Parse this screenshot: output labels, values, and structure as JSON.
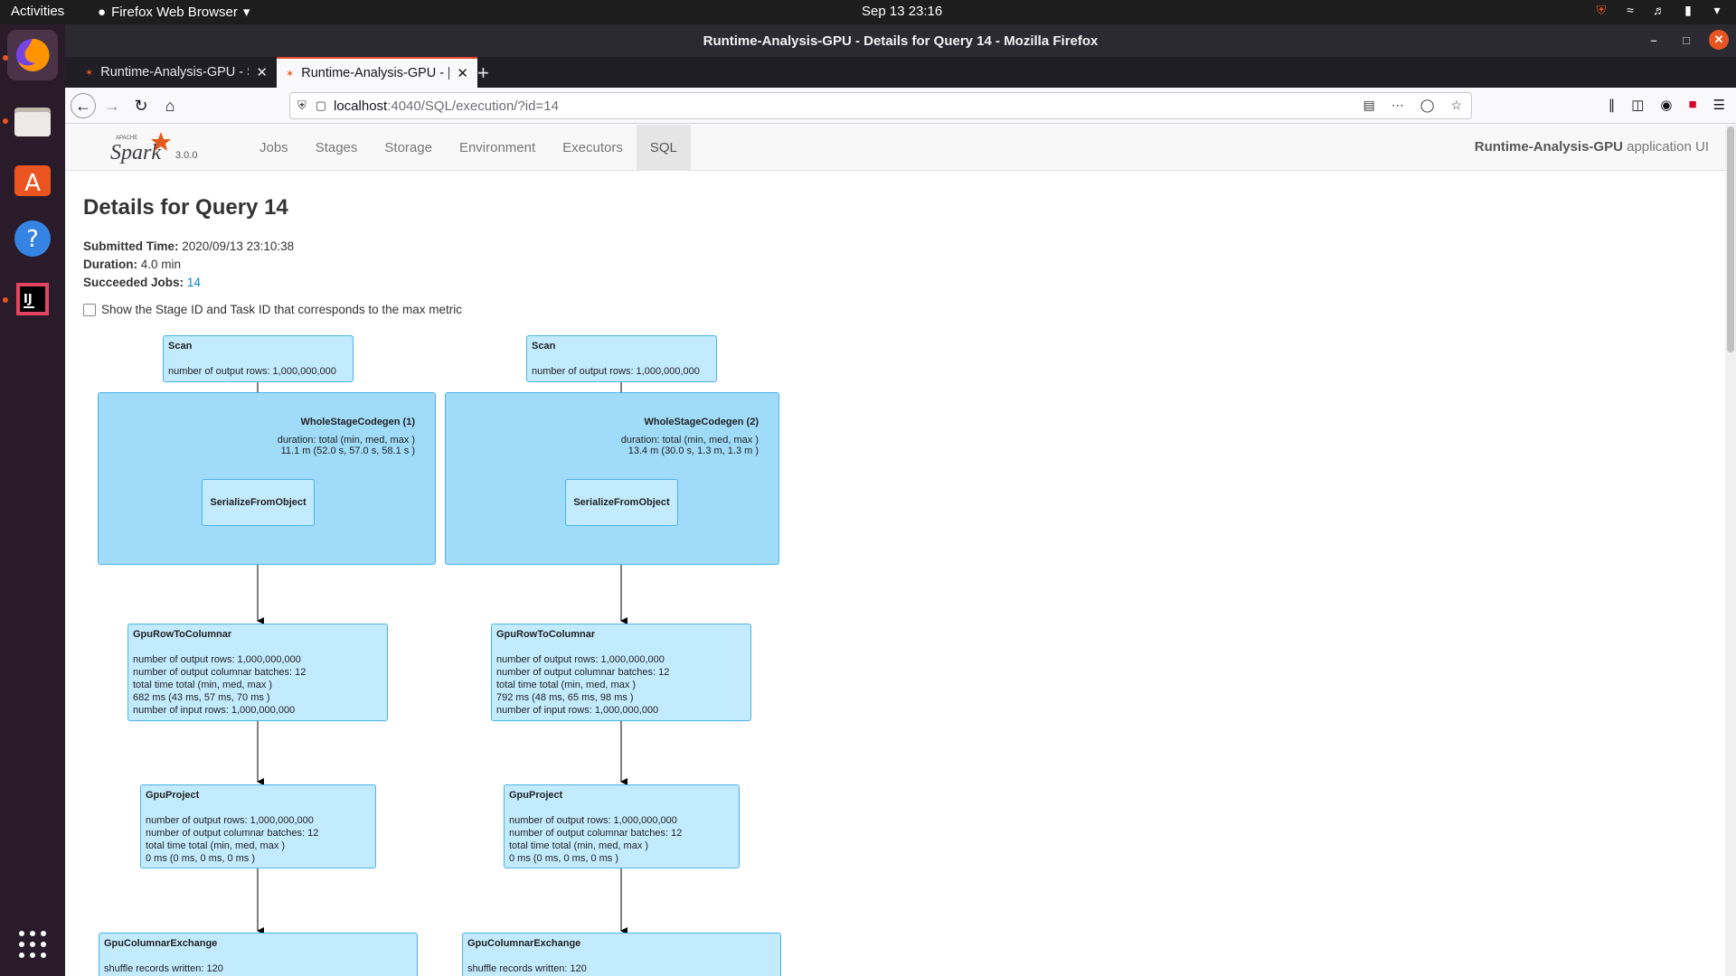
{
  "topbar": {
    "activities": "Activities",
    "app_menu": "Firefox Web Browser",
    "clock": "Sep 13  23:16"
  },
  "window": {
    "title": "Runtime-Analysis-GPU - Details for Query 14 - Mozilla Firefox"
  },
  "tabs": [
    {
      "label": "Runtime-Analysis-GPU - S"
    },
    {
      "label": "Runtime-Analysis-GPU - [ "
    }
  ],
  "url": {
    "host": "localhost",
    "path": ":4040/SQL/execution/?id=14"
  },
  "spark": {
    "version": "3.0.0",
    "nav": [
      "Jobs",
      "Stages",
      "Storage",
      "Environment",
      "Executors",
      "SQL"
    ],
    "active_nav": "SQL",
    "app_name_bold": "Runtime-Analysis-GPU",
    "app_name_suffix": " application UI"
  },
  "page": {
    "title": "Details for Query 14",
    "submitted_label": "Submitted Time:",
    "submitted_value": " 2020/09/13 23:10:38",
    "duration_label": "Duration:",
    "duration_value": " 4.0 min",
    "jobs_label": "Succeeded Jobs:",
    "jobs_value": "14",
    "checkbox_label": "Show the Stage ID and Task ID that corresponds to the max metric"
  },
  "plan": {
    "left": {
      "scan": {
        "name": "Scan",
        "metrics": [
          "number of output rows: 1,000,000,000"
        ]
      },
      "codegen": {
        "name": "WholeStageCodegen (1)",
        "metrics": [
          "duration: total (min, med, max )",
          "11.1 m (52.0 s, 57.0 s, 58.1 s )"
        ]
      },
      "serialize": {
        "name": "SerializeFromObject"
      },
      "rowtocol": {
        "name": "GpuRowToColumnar",
        "metrics": [
          "number of output rows: 1,000,000,000",
          "number of output columnar batches: 12",
          "total time total (min, med, max )",
          "682 ms (43 ms, 57 ms, 70 ms )",
          "number of input rows: 1,000,000,000"
        ]
      },
      "project": {
        "name": "GpuProject",
        "metrics": [
          "number of output rows: 1,000,000,000",
          "number of output columnar batches: 12",
          "total time total (min, med, max )",
          "0 ms (0 ms, 0 ms, 0 ms )"
        ]
      },
      "exchange": {
        "name": "GpuColumnarExchange",
        "metrics": [
          "shuffle records written: 120"
        ]
      }
    },
    "right": {
      "scan": {
        "name": "Scan",
        "metrics": [
          "number of output rows: 1,000,000,000"
        ]
      },
      "codegen": {
        "name": "WholeStageCodegen (2)",
        "metrics": [
          "duration: total (min, med, max )",
          "13.4 m (30.0 s, 1.3 m, 1.3 m )"
        ]
      },
      "serialize": {
        "name": "SerializeFromObject"
      },
      "rowtocol": {
        "name": "GpuRowToColumnar",
        "metrics": [
          "number of output rows: 1,000,000,000",
          "number of output columnar batches: 12",
          "total time total (min, med, max )",
          "792 ms (48 ms, 65 ms, 98 ms )",
          "number of input rows: 1,000,000,000"
        ]
      },
      "project": {
        "name": "GpuProject",
        "metrics": [
          "number of output rows: 1,000,000,000",
          "number of output columnar batches: 12",
          "total time total (min, med, max )",
          "0 ms (0 ms, 0 ms, 0 ms )"
        ]
      },
      "exchange": {
        "name": "GpuColumnarExchange",
        "metrics": [
          "shuffle records written: 120"
        ]
      }
    }
  },
  "colors": {
    "node_fill": "#c3ebff",
    "cluster_fill": "#a0dcfa",
    "node_border": "#4bb1e6",
    "link": "#0088cc",
    "ubuntu_orange": "#e95420"
  }
}
